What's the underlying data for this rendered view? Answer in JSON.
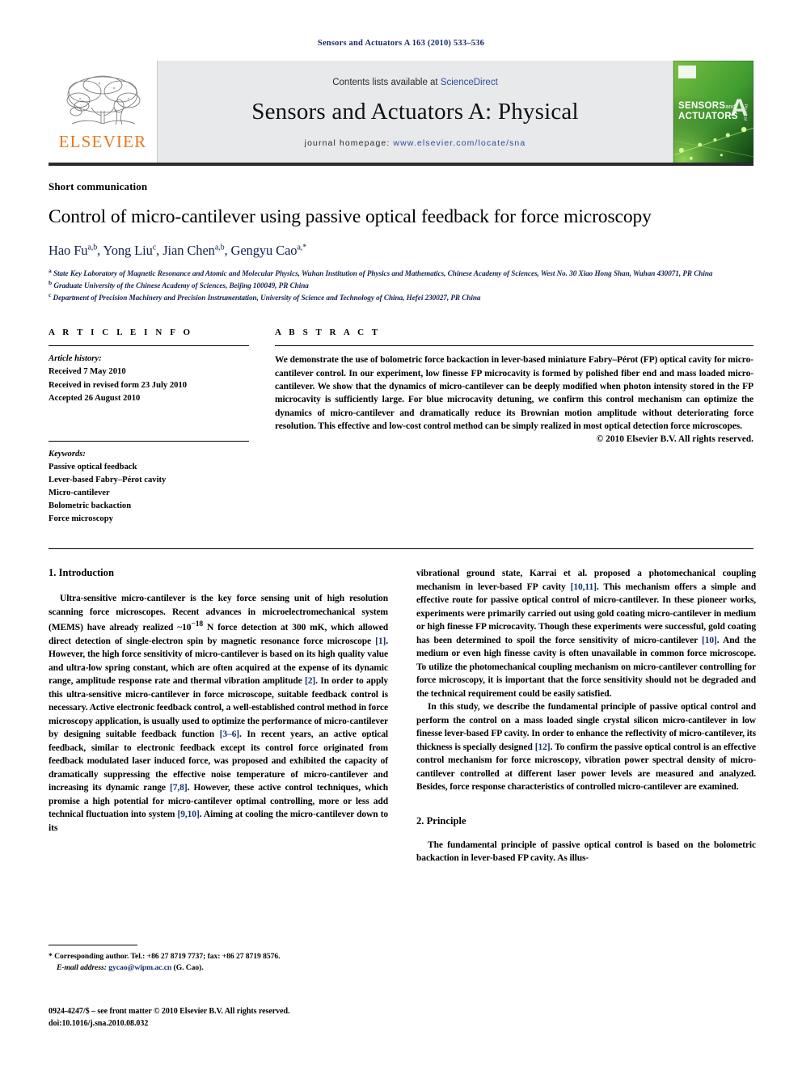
{
  "running_head": "Sensors and Actuators A 163 (2010) 533–536",
  "masthead": {
    "publisher_name": "ELSEVIER",
    "contents_prefix": "Contents lists available at ",
    "contents_link": "ScienceDirect",
    "journal_title": "Sensors and Actuators A: Physical",
    "homepage_prefix": "journal homepage:",
    "homepage_url": "www.elsevier.com/locate/sna",
    "cover": {
      "line1": "SENSORS",
      "line1_small": "and",
      "line2": "ACTUATORS",
      "letter": "A",
      "letter_sub": "Physical"
    }
  },
  "article": {
    "type_label": "Short communication",
    "title": "Control of micro-cantilever using passive optical feedback for force microscopy",
    "authors_html": "Hao Fu",
    "authors": "Hao Fu a,b, Yong Liu c, Jian Chen a,b, Gengyu Cao a,*",
    "affiliations": [
      "State Key Laboratory of Magnetic Resonance and Atomic and Molecular Physics, Wuhan Institution of Physics and Mathematics, Chinese Academy of Sciences, West No. 30 Xiao Hong Shan, Wuhan 430071, PR China",
      "Graduate University of the Chinese Academy of Sciences, Beijing 100049, PR China",
      "Department of Precision Machinery and Precision Instrumentation, University of Science and Technology of China, Hefei 230027, PR China"
    ]
  },
  "info": {
    "heading": "A R T I C L E    I N F O",
    "history_label": "Article history:",
    "history": [
      "Received 7 May 2010",
      "Received in revised form 23 July 2010",
      "Accepted 26 August 2010"
    ],
    "keywords_label": "Keywords:",
    "keywords": [
      "Passive optical feedback",
      "Lever-based Fabry–Pérot cavity",
      "Micro-cantilever",
      "Bolometric backaction",
      "Force microscopy"
    ]
  },
  "abstract": {
    "heading": "A B S T R A C T",
    "text": "We demonstrate the use of bolometric force backaction in lever-based miniature Fabry–Pérot (FP) optical cavity for micro-cantilever control. In our experiment, low finesse FP microcavity is formed by polished fiber end and mass loaded micro-cantilever. We show that the dynamics of micro-cantilever can be deeply modified when photon intensity stored in the FP microcavity is sufficiently large. For blue microcavity detuning, we confirm this control mechanism can optimize the dynamics of micro-cantilever and dramatically reduce its Brownian motion amplitude without deteriorating force resolution. This effective and low-cost control method can be simply realized in most optical detection force microscopes.",
    "copyright": "© 2010 Elsevier B.V. All rights reserved."
  },
  "sections": {
    "introduction_heading": "1.  Introduction",
    "principle_heading": "2.  Principle",
    "intro_p1_a": "Ultra-sensitive micro-cantilever is the key force sensing unit of high resolution scanning force microscopes. Recent advances in microelectromechanical system (MEMS) have already realized ~10",
    "intro_p1_sup": "−18",
    "intro_p1_b": " N force detection at 300 mK, which allowed direct detection of single-electron spin by magnetic resonance force microscope ",
    "ref1": "[1]",
    "intro_p1_c": ". However, the high force sensitivity of micro-cantilever is based on its high quality value and ultra-low spring constant, which are often acquired at the expense of its dynamic range, amplitude response rate and thermal vibration amplitude ",
    "ref2": "[2]",
    "intro_p1_d": ". In order to apply this ultra-sensitive micro-cantilever in force microscope, suitable feedback control is necessary. Active electronic feedback control, a well-established control method in force microscopy application, is usually used to optimize the performance of micro-cantilever by designing suitable feedback function ",
    "ref36": "[3–6]",
    "intro_p1_e": ". In recent years, an active optical feedback, similar to electronic feedback except its control force originated from feedback modulated laser induced force, was proposed and exhibited the capacity of dramatically suppressing the effective noise temperature of micro-cantilever and increasing its dynamic range ",
    "ref78": "[7,8]",
    "intro_p1_f": ". However, these active control techniques, which promise a high potential for micro-cantilever optimal controlling, more or less add technical fluctuation into system ",
    "ref910": "[9,10]",
    "intro_p1_g": ". Aiming at cooling the micro-cantilever down to its vibrational ground state, Karrai et al. proposed a photomechanical coupling mechanism in lever-based FP cavity ",
    "ref1011": "[10,11]",
    "intro_p1_h": ". This mechanism offers a simple and effective route for passive optical control of micro-cantilever. In these pioneer works, experiments were primarily carried out using gold coating micro-cantilever in medium or high finesse FP microcavity. Though these experiments were successful, gold coating has been determined to spoil the force sensitivity of micro-cantilever ",
    "ref10": "[10]",
    "intro_p1_i": ". And the medium or even high finesse cavity is often unavailable in common force microscope. To utilize the photomechanical coupling mechanism on micro-cantilever controlling for force microscopy, it is important that the force sensitivity should not be degraded and the technical requirement could be easily satisfied.",
    "intro_p2_a": "In this study, we describe the fundamental principle of passive optical control and perform the control on a mass loaded single crystal silicon micro-cantilever in low finesse lever-based FP cavity. In order to enhance the reflectivity of micro-cantilever, its thickness is specially designed ",
    "ref12": "[12]",
    "intro_p2_b": ". To confirm the passive optical control is an effective control mechanism for force microscopy, vibration power spectral density of micro-cantilever controlled at different laser power levels are measured and analyzed. Besides, force response characteristics of controlled micro-cantilever are examined.",
    "principle_p1": "The fundamental principle of passive optical control is based on the bolometric backaction in lever-based FP cavity. As illus-"
  },
  "footnotes": {
    "corresponding": "* Corresponding author. Tel.: +86 27 8719 7737; fax: +86 27 8719 8576.",
    "email_label": "E-mail address:",
    "email": "gycao@wipm.ac.cn",
    "email_suffix": "(G. Cao).",
    "issn_line": "0924-4247/$ – see front matter © 2010 Elsevier B.V. All rights reserved.",
    "doi_line": "doi:10.1016/j.sna.2010.08.032"
  },
  "colors": {
    "link": "#2b4b9b",
    "reference": "#14306b",
    "elsevier_orange": "#e87722",
    "masthead_bg": "#e8e9eb",
    "author_navy": "#12224f"
  }
}
